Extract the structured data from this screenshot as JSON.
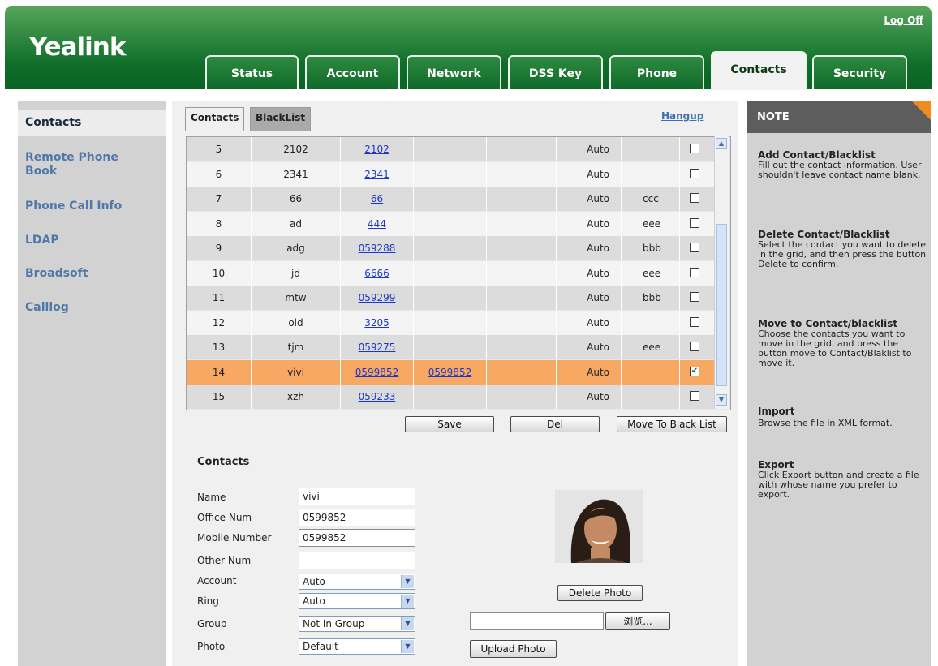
{
  "header": {
    "logo": "Yealink",
    "logoff": "Log Off",
    "tabs": [
      "Status",
      "Account",
      "Network",
      "DSS Key",
      "Phone",
      "Contacts",
      "Security"
    ],
    "active_tab": "Contacts"
  },
  "sidebar": {
    "items": [
      "Contacts",
      "Remote Phone Book",
      "Phone Call Info",
      "LDAP",
      "Broadsoft",
      "Calllog"
    ],
    "active": "Contacts"
  },
  "subtabs": [
    "Contacts",
    "BlackList"
  ],
  "hangup": "Hangup",
  "table": {
    "rows": [
      {
        "idx": "5",
        "name": "2102",
        "office": "2102",
        "mobile": "",
        "other": "",
        "account": "Auto",
        "group": "",
        "checked": false,
        "selected": false
      },
      {
        "idx": "6",
        "name": "2341",
        "office": "2341",
        "mobile": "",
        "other": "",
        "account": "Auto",
        "group": "",
        "checked": false,
        "selected": false
      },
      {
        "idx": "7",
        "name": "66",
        "office": "66",
        "mobile": "",
        "other": "",
        "account": "Auto",
        "group": "ccc",
        "checked": false,
        "selected": false
      },
      {
        "idx": "8",
        "name": "ad",
        "office": "444",
        "mobile": "",
        "other": "",
        "account": "Auto",
        "group": "eee",
        "checked": false,
        "selected": false
      },
      {
        "idx": "9",
        "name": "adg",
        "office": "059288",
        "mobile": "",
        "other": "",
        "account": "Auto",
        "group": "bbb",
        "checked": false,
        "selected": false
      },
      {
        "idx": "10",
        "name": "jd",
        "office": "6666",
        "mobile": "",
        "other": "",
        "account": "Auto",
        "group": "eee",
        "checked": false,
        "selected": false
      },
      {
        "idx": "11",
        "name": "mtw",
        "office": "059299",
        "mobile": "",
        "other": "",
        "account": "Auto",
        "group": "bbb",
        "checked": false,
        "selected": false
      },
      {
        "idx": "12",
        "name": "old",
        "office": "3205",
        "mobile": "",
        "other": "",
        "account": "Auto",
        "group": "",
        "checked": false,
        "selected": false
      },
      {
        "idx": "13",
        "name": "tjm",
        "office": "059275",
        "mobile": "",
        "other": "",
        "account": "Auto",
        "group": "eee",
        "checked": false,
        "selected": false
      },
      {
        "idx": "14",
        "name": "vivi",
        "office": "0599852",
        "mobile": "0599852",
        "other": "",
        "account": "Auto",
        "group": "",
        "checked": true,
        "selected": true
      },
      {
        "idx": "15",
        "name": "xzh",
        "office": "059233",
        "mobile": "",
        "other": "",
        "account": "Auto",
        "group": "",
        "checked": false,
        "selected": false
      }
    ]
  },
  "buttons": {
    "save": "Save",
    "del": "Del",
    "move_black": "Move To Black List",
    "delete_photo": "Delete Photo",
    "browse": "浏览...",
    "upload_photo": "Upload Photo"
  },
  "form": {
    "title": "Contacts",
    "name_label": "Name",
    "name_value": "vivi",
    "office_label": "Office Num",
    "office_value": "0599852",
    "mobile_label": "Mobile Number",
    "mobile_value": "0599852",
    "other_label": "Other Num",
    "other_value": "",
    "account_label": "Account",
    "account_value": "Auto",
    "ring_label": "Ring",
    "ring_value": "Auto",
    "group_label": "Group",
    "group_value": "Not In Group",
    "photo_label": "Photo",
    "photo_value": "Default"
  },
  "note": {
    "title": "NOTE",
    "sections": [
      {
        "heading": "Add Contact/Blacklist",
        "text": "Fill out the contact information. User shouldn't leave contact name blank."
      },
      {
        "heading": "Delete Contact/Blacklist",
        "text": "Select the contact you want to delete in the grid, and then press the button Delete to confirm."
      },
      {
        "heading": "Move to Contact/blacklist",
        "text": "Choose the contacts you want to move in the grid, and press the button move to Contact/Blaklist to move it."
      },
      {
        "heading": "Import",
        "text": "Browse the file in XML format."
      },
      {
        "heading": "Export",
        "text": "Click Export button and create a file with whose name you prefer to export."
      }
    ]
  },
  "colors": {
    "header_green": "#0f6e2a",
    "selected_row": "#f7a863",
    "link_blue": "#1a37c8",
    "nav_blue": "#4f78a8",
    "note_accent": "#f08c1f"
  }
}
